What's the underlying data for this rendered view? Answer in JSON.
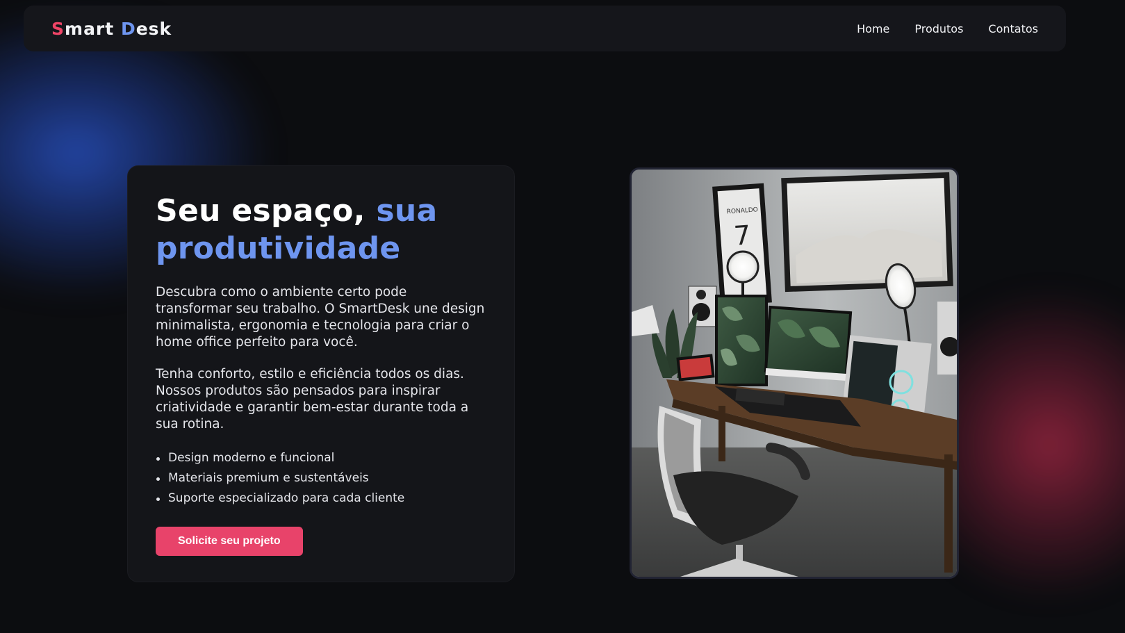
{
  "navbar": {
    "logo": {
      "s": "S",
      "mart": "mart",
      "d": "D",
      "esk": "esk"
    },
    "links": [
      {
        "label": "Home"
      },
      {
        "label": "Produtos"
      },
      {
        "label": "Contatos"
      }
    ]
  },
  "hero": {
    "title_main": "Seu espaço,",
    "title_accent": "sua produtividade",
    "paragraph_1": "Descubra como o ambiente certo pode transformar seu trabalho. O SmartDesk une design minimalista, ergonomia e tecnologia para criar o home office perfeito para você.",
    "paragraph_2": "Tenha conforto, estilo e eficiência todos os dias. Nossos produtos são pensados para inspirar criatividade e garantir bem-estar durante toda a sua rotina.",
    "bullets": [
      "Design moderno e funcional",
      "Materiais premium e sustentáveis",
      "Suporte especializado para cada cliente"
    ],
    "cta_label": "Solicite seu projeto",
    "image": {
      "icon": "desk-setup-photo",
      "jersey_name": "RONALDO",
      "jersey_number": "7"
    }
  },
  "colors": {
    "accent_blue": "#6e95ef",
    "accent_pink": "#e8436a",
    "background": "#0c0d10",
    "card": "#141519"
  }
}
